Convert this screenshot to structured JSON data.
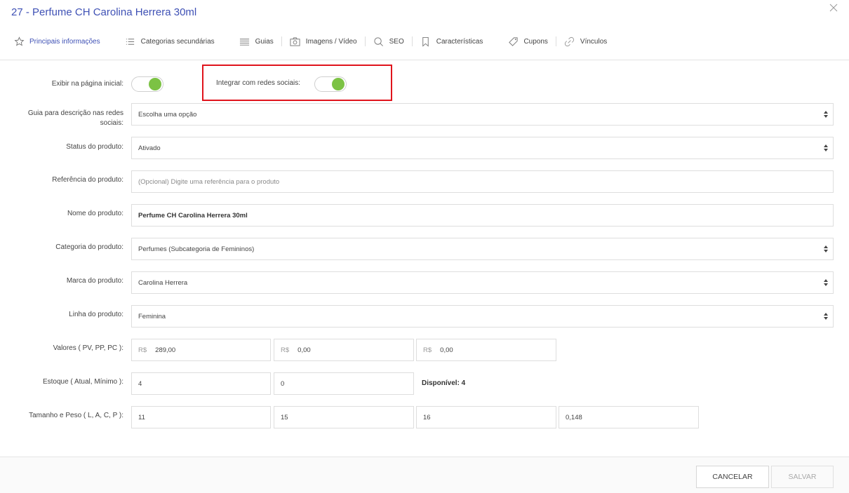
{
  "title": "27 - Perfume CH Carolina Herrera 30ml",
  "tabs": [
    {
      "label": "Principais informações",
      "icon": "star-icon",
      "active": true
    },
    {
      "label": "Categorias secundárias",
      "icon": "list-icon"
    },
    {
      "label": "Guias",
      "icon": "lines-icon"
    },
    {
      "label": "Imagens / Vídeo",
      "icon": "camera-icon"
    },
    {
      "label": "SEO",
      "icon": "search-icon"
    },
    {
      "label": "Características",
      "icon": "bookmark-icon"
    },
    {
      "label": "Cupons",
      "icon": "tag-icon"
    },
    {
      "label": "Vínculos",
      "icon": "link-icon"
    }
  ],
  "form": {
    "show_home_label": "Exibir na página inicial:",
    "show_home_on": true,
    "social_label": "Integrar com redes sociais:",
    "social_on": true,
    "guide_label": "Guia para descrição nas redes sociais:",
    "guide_value": "Escolha uma opção",
    "status_label": "Status do produto:",
    "status_value": "Ativado",
    "reference_label": "Referência do produto:",
    "reference_placeholder": "(Opcional) Digite uma referência para o produto",
    "name_label": "Nome do produto:",
    "name_value": "Perfume CH Carolina Herrera 30ml",
    "category_label": "Categoria do produto:",
    "category_value": "Perfumes (Subcategoria de Femininos)",
    "brand_label": "Marca do produto:",
    "brand_value": "Carolina Herrera",
    "line_label": "Linha do produto:",
    "line_value": "Feminina",
    "prices_label": "Valores ( PV, PP, PC ):",
    "currency": "R$",
    "price_pv": "289,00",
    "price_pp": "0,00",
    "price_pc": "0,00",
    "stock_label": "Estoque ( Atual, Mínimo ):",
    "stock_current": "4",
    "stock_min": "0",
    "available": "Disponível: 4",
    "size_label": "Tamanho e Peso ( L, A, C, P ):",
    "size_l": "11",
    "size_a": "15",
    "size_c": "16",
    "weight": "0,148"
  },
  "footer": {
    "cancel": "CANCELAR",
    "save": "SALVAR"
  },
  "colors": {
    "accent": "#3f51b5",
    "toggle_on": "#7cc244",
    "highlight": "#e0141c"
  }
}
